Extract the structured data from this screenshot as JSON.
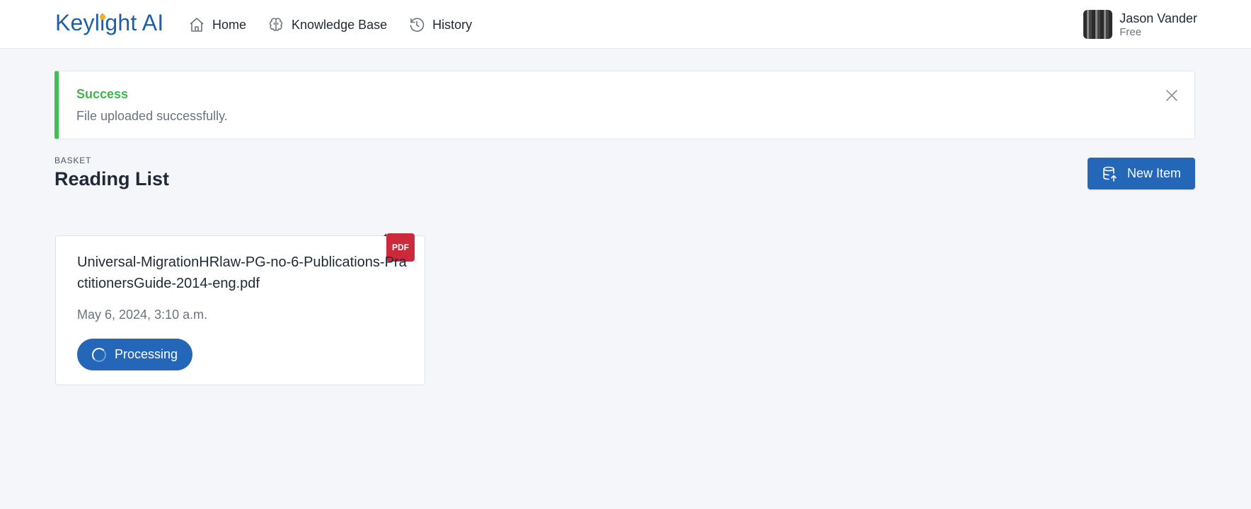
{
  "app": {
    "logo_text_before": "Keyl",
    "logo_text_i": "i",
    "logo_text_after": "ght AI",
    "brand_color": "#1f5fa8",
    "accent_color": "#f2b01e"
  },
  "nav": {
    "items": [
      {
        "label": "Home",
        "icon": "home-icon"
      },
      {
        "label": "Knowledge Base",
        "icon": "brain-icon"
      },
      {
        "label": "History",
        "icon": "history-icon"
      }
    ]
  },
  "user": {
    "name": "Jason Vander",
    "plan": "Free"
  },
  "alert": {
    "title": "Success",
    "message": "File uploaded successfully.",
    "status_color": "#3fbf55"
  },
  "header": {
    "section_label": "BASKET",
    "title": "Reading List",
    "new_item_label": "New Item"
  },
  "items": [
    {
      "file_type": "PDF",
      "file_name": "Universal-MigrationHRlaw-PG-no-6-Publications-PractitionersGuide-2014-eng.pdf",
      "date": "May 6, 2024, 3:10 a.m.",
      "status": "Processing"
    }
  ]
}
